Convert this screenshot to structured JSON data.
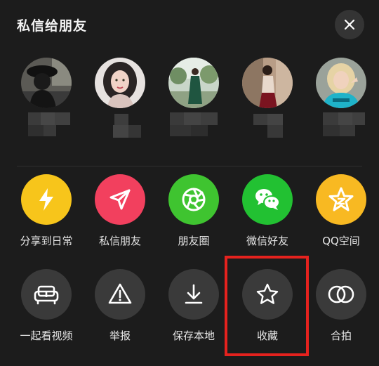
{
  "header": {
    "title": "私信给朋友"
  },
  "share_row": [
    {
      "label": "分享到日常",
      "icon": "lightning-icon",
      "color": "#f7c51b"
    },
    {
      "label": "私信朋友",
      "icon": "paper-plane-icon",
      "color": "#f2405e"
    },
    {
      "label": "朋友圈",
      "icon": "moments-shutter-icon",
      "color": "#3fc430"
    },
    {
      "label": "微信好友",
      "icon": "wechat-icon",
      "color": "#22c132"
    },
    {
      "label": "QQ空间",
      "icon": "qzone-star-icon",
      "color": "#f8b922"
    }
  ],
  "action_row": [
    {
      "label": "一起看视频",
      "icon": "sofa-icon"
    },
    {
      "label": "举报",
      "icon": "warning-icon"
    },
    {
      "label": "保存本地",
      "icon": "download-icon"
    },
    {
      "label": "收藏",
      "icon": "star-icon"
    },
    {
      "label": "合拍",
      "icon": "duet-circles-icon"
    }
  ],
  "colors": {
    "background": "#1c1c1c",
    "highlight_border": "#e5221e",
    "action_circle": "#3a3a3a"
  }
}
